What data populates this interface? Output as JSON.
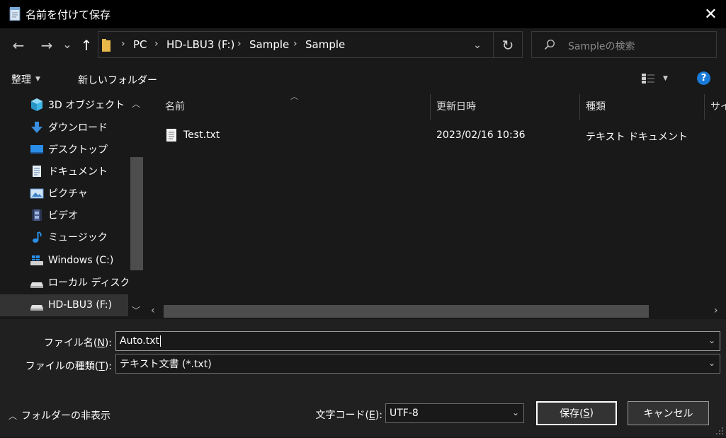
{
  "window": {
    "title": "名前を付けて保存",
    "close_glyph": "✕"
  },
  "nav": {
    "back_glyph": "←",
    "forward_glyph": "→",
    "recent_glyph": "⌄",
    "up_glyph": "↑",
    "breadcrumb": [
      "PC",
      "HD-LBU3 (F:)",
      "Sample",
      "Sample"
    ],
    "refresh_glyph": "↻",
    "search_placeholder": "Sampleの検索"
  },
  "toolbar": {
    "organize_label": "整理",
    "new_folder_label": "新しいフォルダー",
    "help_glyph": "?"
  },
  "sidebar": {
    "items": [
      {
        "label": "3D オブジェクト",
        "icon": "cube-icon"
      },
      {
        "label": "ダウンロード",
        "icon": "download-icon"
      },
      {
        "label": "デスクトップ",
        "icon": "desktop-icon"
      },
      {
        "label": "ドキュメント",
        "icon": "document-icon"
      },
      {
        "label": "ピクチャ",
        "icon": "picture-icon"
      },
      {
        "label": "ビデオ",
        "icon": "video-icon"
      },
      {
        "label": "ミュージック",
        "icon": "music-icon"
      },
      {
        "label": "Windows (C:)",
        "icon": "windows-drive-icon"
      },
      {
        "label": "ローカル ディスク (D",
        "icon": "drive-icon"
      },
      {
        "label": "HD-LBU3 (F:)",
        "icon": "drive-icon",
        "selected": true
      }
    ]
  },
  "file_list": {
    "columns": [
      "名前",
      "更新日時",
      "種類",
      "サイ"
    ],
    "rows": [
      {
        "name": "Test.txt",
        "modified": "2023/02/16 10:36",
        "type": "テキスト ドキュメント"
      }
    ]
  },
  "form": {
    "filename_label": "ファイル名(",
    "filename_key": "N",
    "filename_label_end": "):",
    "filename_value": "Auto.txt",
    "filetype_label": "ファイルの種類(",
    "filetype_key": "T",
    "filetype_label_end": "):",
    "filetype_value": "テキスト文書 (*.txt)",
    "encoding_label": "文字コード(",
    "encoding_key": "E",
    "encoding_label_end": "):",
    "encoding_value": "UTF-8"
  },
  "footer": {
    "hide_folders_label": "フォルダーの非表示",
    "save_label": "保存(",
    "save_key": "S",
    "save_label_end": ")",
    "cancel_label": "キャンセル"
  }
}
